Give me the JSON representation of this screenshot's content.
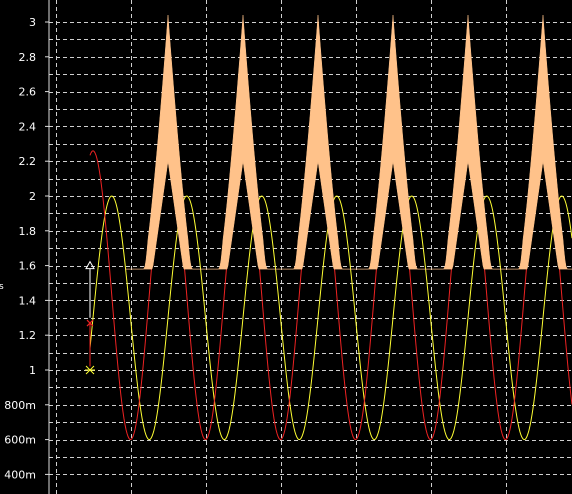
{
  "chart_data": {
    "type": "line",
    "title": "",
    "xlabel": "",
    "ylabel": "",
    "ylim": [
      0.33,
      3.07
    ],
    "y_ticks": [
      {
        "value": 3.0,
        "label": "3"
      },
      {
        "value": 2.8,
        "label": "2.8"
      },
      {
        "value": 2.6,
        "label": "2.6"
      },
      {
        "value": 2.4,
        "label": "2.4"
      },
      {
        "value": 2.2,
        "label": "2.2"
      },
      {
        "value": 2.0,
        "label": "2"
      },
      {
        "value": 1.8,
        "label": "1.8"
      },
      {
        "value": 1.6,
        "label": "1.6"
      },
      {
        "value": 1.4,
        "label": "1.4"
      },
      {
        "value": 1.2,
        "label": "1.2"
      },
      {
        "value": 1.0,
        "label": "1"
      },
      {
        "value": 0.8,
        "label": "800m"
      },
      {
        "value": 0.6,
        "label": "600m"
      },
      {
        "value": 0.4,
        "label": "400m"
      }
    ],
    "x_range": [
      0,
      6.9
    ],
    "x_gridlines": [
      0.5,
      1.5,
      2.5,
      3.5,
      4.5,
      5.5,
      6.5
    ],
    "grid": true,
    "series": [
      {
        "color": "#ffff33",
        "marker": "star",
        "marker_value": 1.0,
        "offset": 1.3,
        "amplitude": 0.7,
        "period": 1.0,
        "phase": 0.25
      },
      {
        "color": "#ee2222",
        "marker": "cross",
        "marker_value": 1.27,
        "offset": 1.43,
        "amplitude": 0.83,
        "period": 1.0,
        "phase": 0.0
      },
      {
        "color": "#ffc28a",
        "marker": "triangle",
        "marker_value": 1.6,
        "style": "filled-envelope",
        "min": 1.58,
        "mid": 2.2,
        "max": 3.04,
        "period": 1.0
      }
    ],
    "side_label": "s"
  }
}
